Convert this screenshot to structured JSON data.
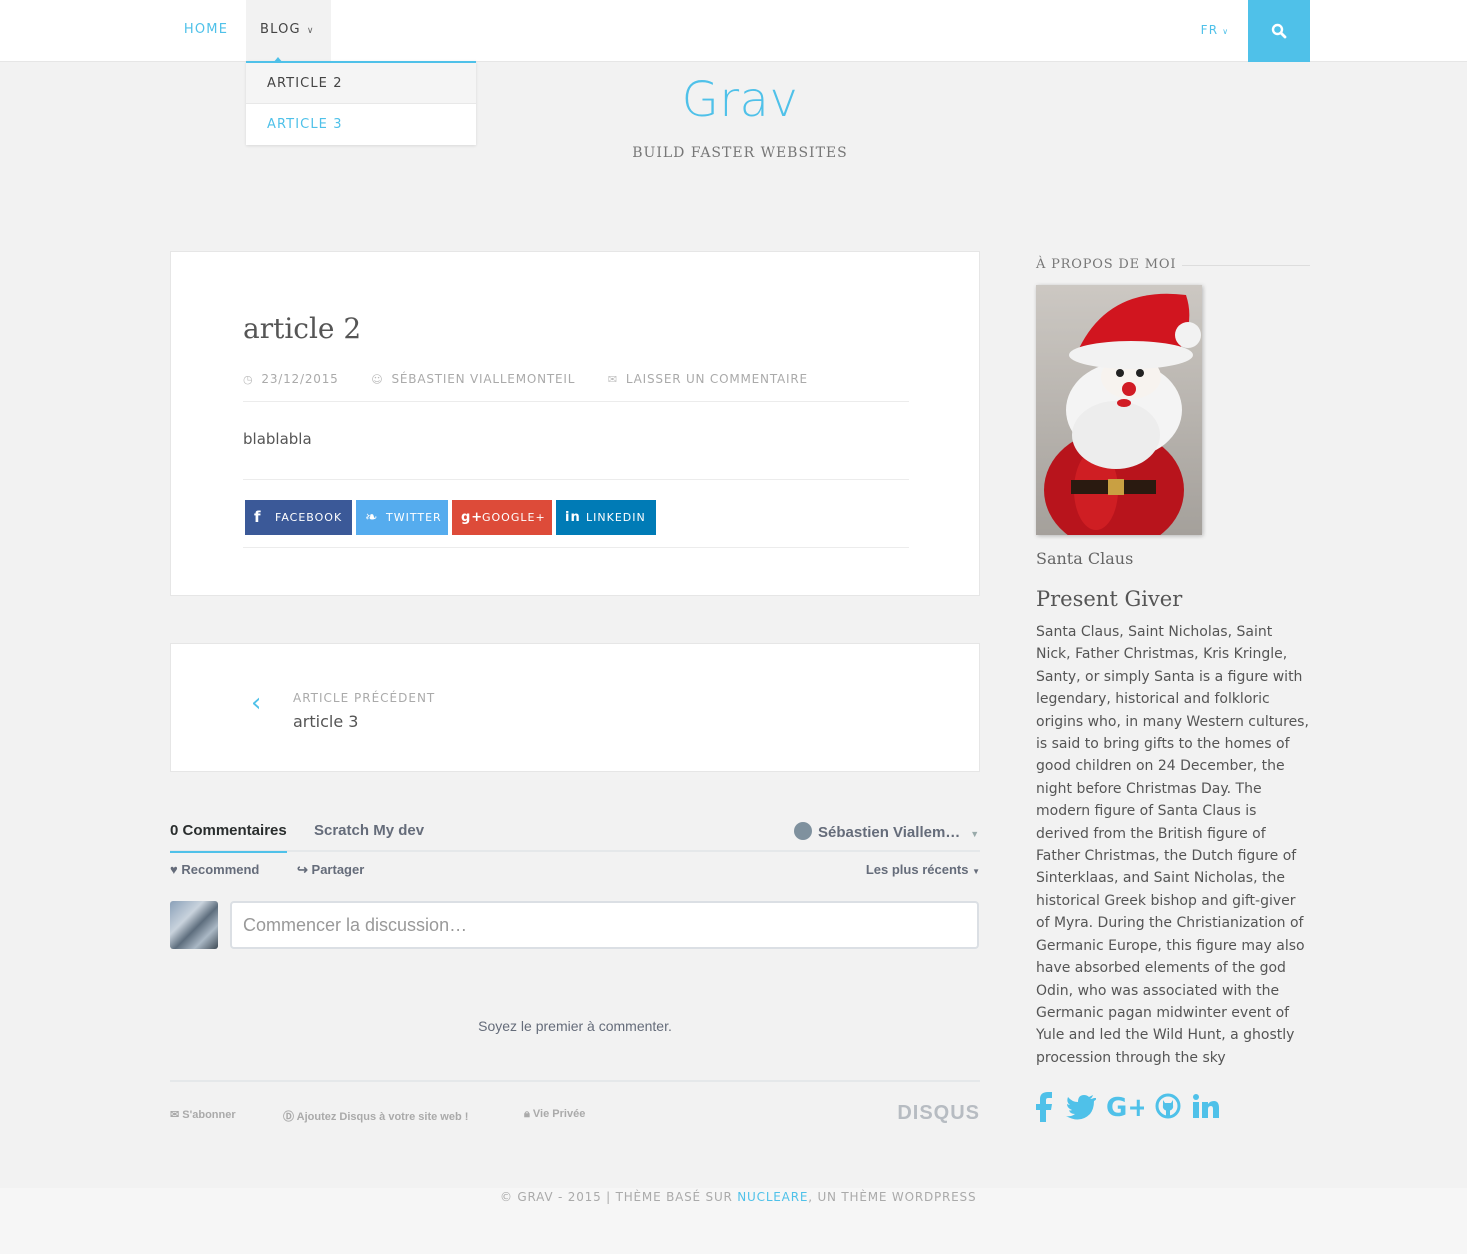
{
  "nav": {
    "home": "HOME",
    "blog": "BLOG",
    "lang": "FR",
    "dropdown": [
      "ARTICLE 2",
      "ARTICLE 3"
    ]
  },
  "site": {
    "title": "Grav",
    "tagline": "BUILD FASTER WEBSITES"
  },
  "article": {
    "title": "article 2",
    "date": "23/12/2015",
    "author": "SÉBASTIEN VIALLEMONTEIL",
    "comment_link": "LAISSER UN COMMENTAIRE",
    "body": "blablabla",
    "share": {
      "facebook": "FACEBOOK",
      "twitter": "TWITTER",
      "google": "GOOGLE+",
      "linkedin": "LINKEDIN"
    }
  },
  "post_nav": {
    "label": "ARTICLE PRÉCÉDENT",
    "title": "article 3"
  },
  "disqus": {
    "tab_comments": "0 Commentaires",
    "tab_site": "Scratch My dev",
    "user": "Sébastien Viallem…",
    "recommend": "Recommend",
    "share": "Partager",
    "sort": "Les plus récents",
    "placeholder": "Commencer la discussion…",
    "first": "Soyez le premier à commenter.",
    "subscribe": "S'abonner",
    "add_disqus": "Ajoutez Disqus à votre site web !",
    "privacy": "Vie Privée",
    "logo": "DISQUS"
  },
  "sidebar": {
    "heading": "À PROPOS DE MOI",
    "caption": "Santa Claus",
    "subtitle": "Present Giver",
    "bio": "Santa Claus, Saint Nicholas, Saint Nick, Father Christmas, Kris Kringle, Santy, or simply Santa is a figure with legendary, historical and folkloric origins who, in many Western cultures, is said to bring gifts to the homes of good children on 24 December, the night before Christmas Day. The modern figure of Santa Claus is derived from the British figure of Father Christmas, the Dutch figure of Sinterklaas, and Saint Nicholas, the historical Greek bishop and gift-giver of Myra. During the Christianization of Germanic Europe, this figure may also have absorbed elements of the god Odin, who was associated with the Germanic pagan midwinter event of Yule and led the Wild Hunt, a ghostly procession through the sky",
    "socials": [
      "facebook-icon",
      "twitter-icon",
      "google-plus-icon",
      "github-icon",
      "linkedin-icon"
    ]
  },
  "footer": {
    "copyright": "© GRAV - 2015 |  THÈME BASÉ SUR ",
    "link": "NUCLEARE",
    "suffix": ", UN THÈME WORDPRESS"
  },
  "colors": {
    "accent": "#4fc1e9",
    "facebook": "#3b5998",
    "twitter": "#55acee",
    "google": "#dd4b39",
    "linkedin": "#007bb6"
  }
}
